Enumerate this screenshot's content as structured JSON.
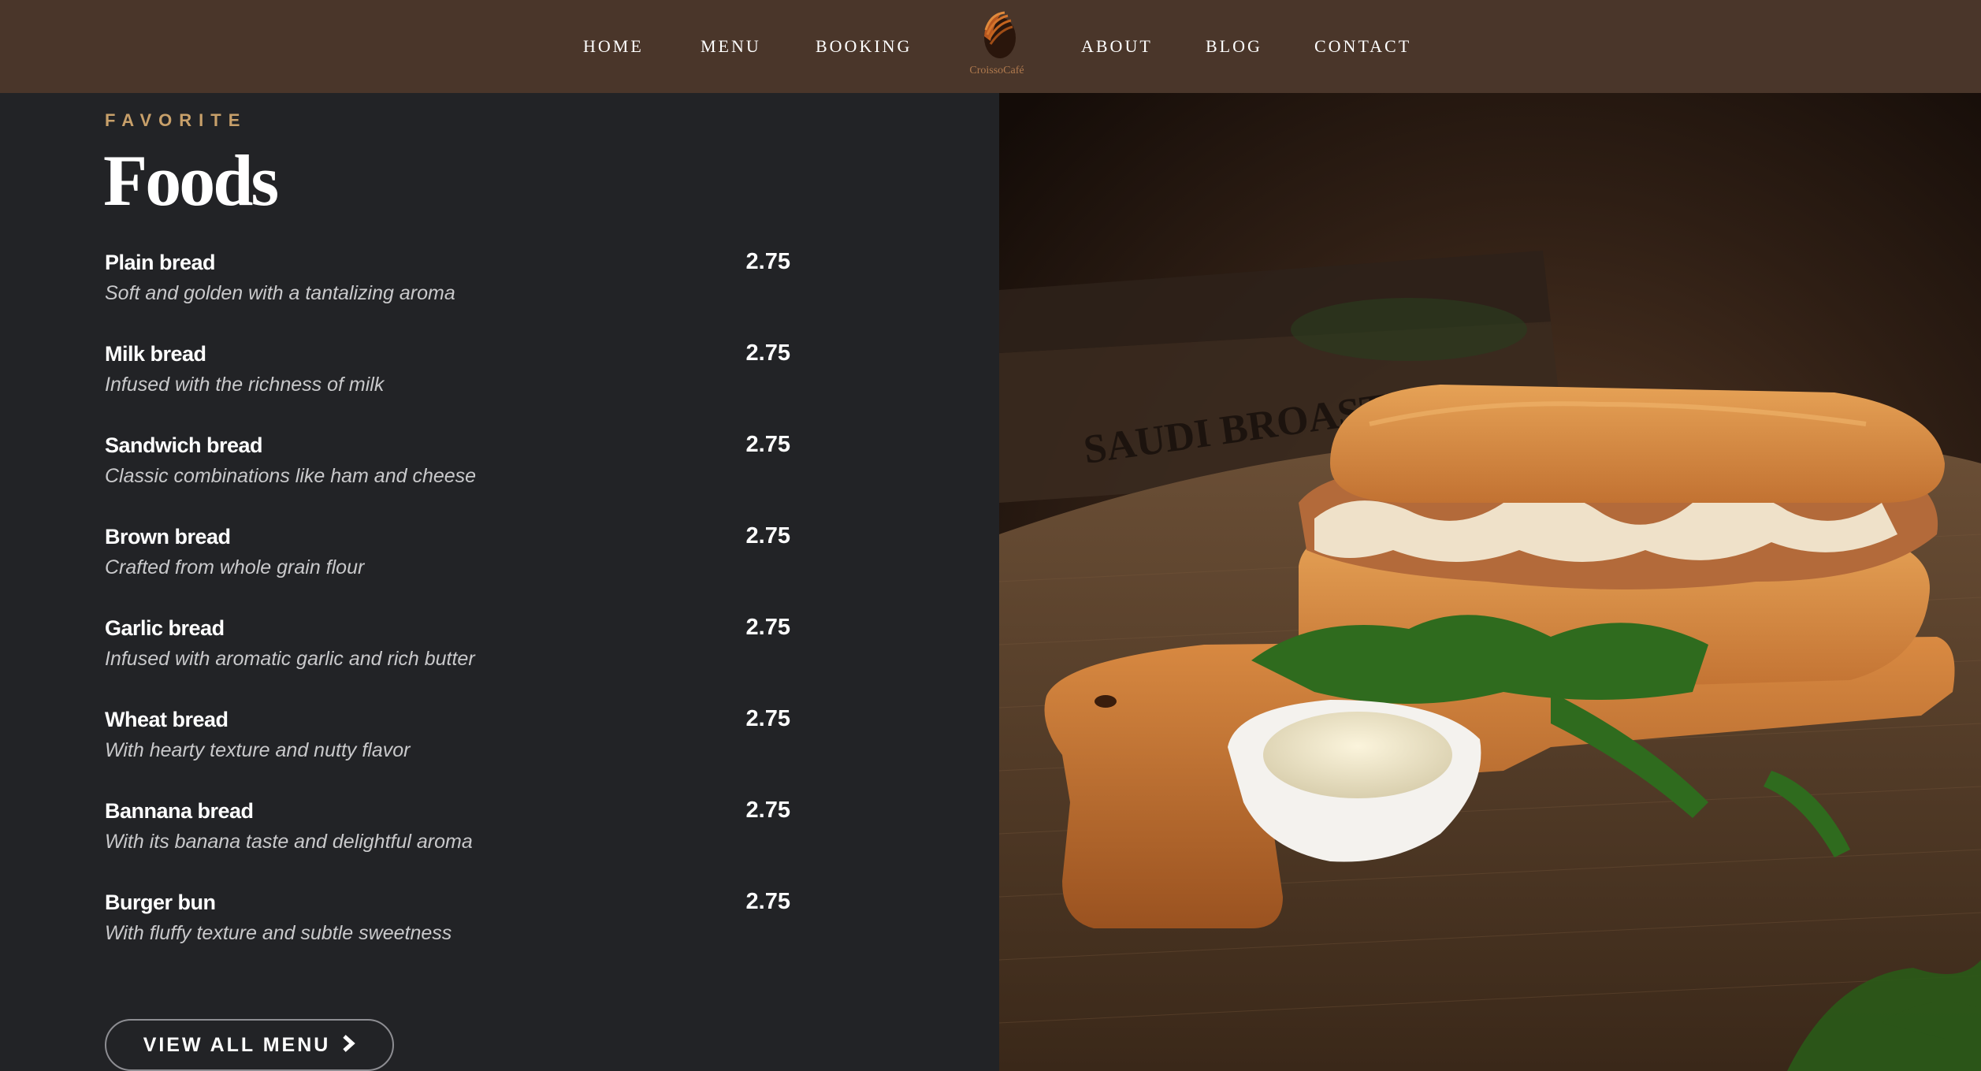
{
  "nav": {
    "links": [
      "HOME",
      "MENU",
      "BOOKING",
      "ABOUT",
      "BLOG",
      "CONTACT"
    ],
    "logo_text": "CroissoCafé"
  },
  "section": {
    "eyebrow": "FAVORITE",
    "title": "Foods"
  },
  "menu_items": [
    {
      "name": "Plain bread",
      "description": "Soft and golden with a tantalizing aroma",
      "price": "2.75"
    },
    {
      "name": "Milk bread",
      "description": "Infused with the richness of milk",
      "price": "2.75"
    },
    {
      "name": "Sandwich bread",
      "description": "Classic combinations like ham and cheese",
      "price": "2.75"
    },
    {
      "name": "Brown bread",
      "description": "Crafted from whole grain flour",
      "price": "2.75"
    },
    {
      "name": "Garlic bread",
      "description": "Infused with aromatic garlic and rich butter",
      "price": "2.75"
    },
    {
      "name": "Wheat bread",
      "description": "With hearty texture and nutty flavor",
      "price": "2.75"
    },
    {
      "name": "Bannana bread",
      "description": "With its banana taste and delightful aroma",
      "price": "2.75"
    },
    {
      "name": "Burger bun",
      "description": "With fluffy texture and subtle sweetness",
      "price": "2.75"
    }
  ],
  "cta": {
    "label": "VIEW ALL MENU",
    "icon": "chevron-right-icon"
  },
  "photo": {
    "crate_text": "SAUDI BROASTED"
  },
  "colors": {
    "nav_bg": "#4a362a",
    "panel_bg": "#222326",
    "accent": "#c8a06a",
    "text": "#ffffff",
    "muted": "#c9c9cb"
  }
}
